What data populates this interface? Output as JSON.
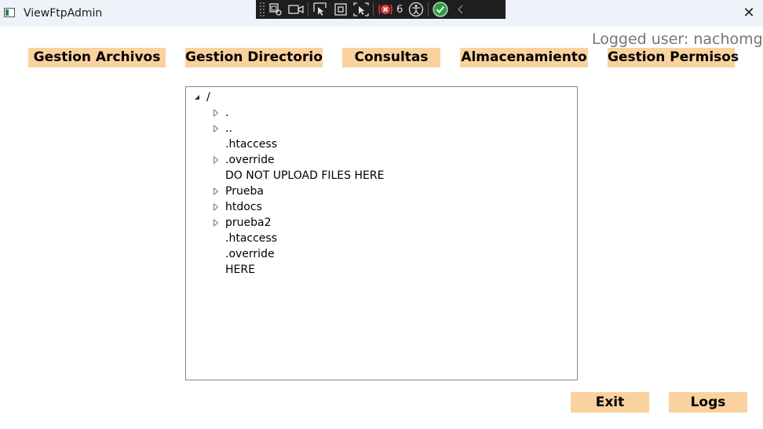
{
  "window": {
    "title": "ViewFtpAdmin",
    "close_glyph": "✕"
  },
  "debug_toolbar": {
    "icons": [
      "select-element-icon",
      "display-layout-adorners-icon",
      "track-focus-icon",
      "show-bindings-icon",
      "binding-failures-icon",
      "accessibility-checker-icon",
      "check-icon",
      "collapse-chevron-icon"
    ],
    "binding_failure_count": "6"
  },
  "header": {
    "logged_user": "Logged user: nachomgp"
  },
  "nav": {
    "gestion_archivos": "Gestion Archivos",
    "gestion_directorio": "Gestion Directorio",
    "consultas": "Consultas",
    "almacenamiento": "Almacenamiento",
    "gestion_permisos": "Gestion Permisos"
  },
  "tree": {
    "root": {
      "label": "/",
      "expanded": true
    },
    "items": [
      {
        "label": ".",
        "expandable": true
      },
      {
        "label": "..",
        "expandable": true
      },
      {
        "label": ".htaccess",
        "expandable": false
      },
      {
        "label": ".override",
        "expandable": true
      },
      {
        "label": "DO NOT UPLOAD FILES HERE",
        "expandable": false
      },
      {
        "label": "Prueba",
        "expandable": true
      },
      {
        "label": "htdocs",
        "expandable": true
      },
      {
        "label": "prueba2",
        "expandable": true
      },
      {
        "label": ".htaccess",
        "expandable": false
      },
      {
        "label": ".override",
        "expandable": false
      },
      {
        "label": "HERE",
        "expandable": false
      }
    ]
  },
  "footer": {
    "exit": "Exit",
    "logs": "Logs"
  },
  "colors": {
    "button_bg": "#f9d29e",
    "titlebar_bg": "#eef3fa",
    "logged_user_text": "#757575"
  }
}
